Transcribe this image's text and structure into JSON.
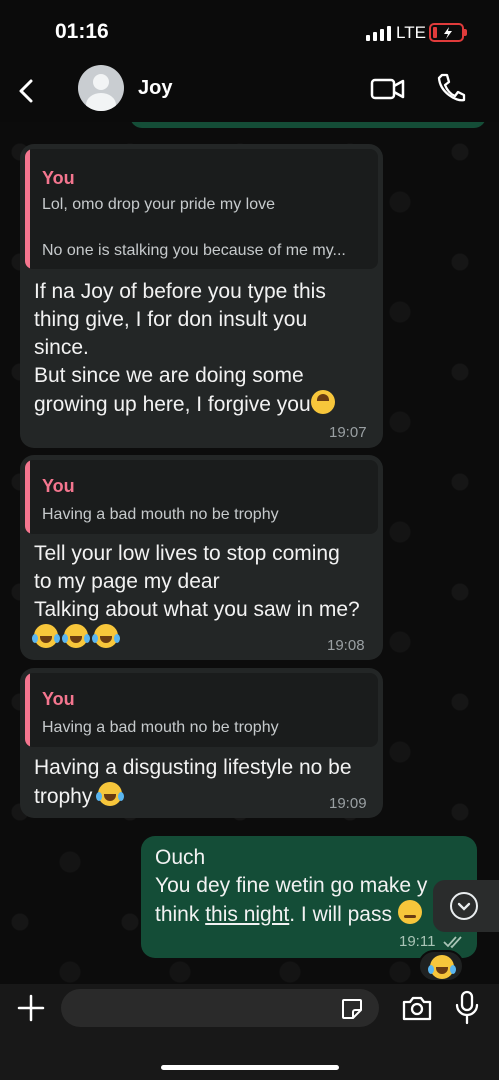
{
  "status_bar": {
    "time": "01:16",
    "network": "LTE"
  },
  "header": {
    "contact_name": "Joy"
  },
  "messages": [
    {
      "quote_author": "You",
      "quote_line1": "Lol, omo drop your pride my love",
      "quote_line2": "No one is stalking you because of me my...",
      "lines": [
        "If na Joy of before you type this",
        "thing give, I for don insult you",
        "since.",
        "But since we are doing some",
        "growing up here, I forgive you"
      ],
      "time": "19:07"
    },
    {
      "quote_author": "You",
      "quote_line1": "Having a bad mouth no be trophy",
      "lines": [
        "Tell your low lives to stop coming",
        "to my page my dear",
        "Talking about what you saw in me?"
      ],
      "time": "19:08"
    },
    {
      "quote_author": "You",
      "quote_line1": "Having a bad mouth no be trophy",
      "lines": [
        "Having a disgusting lifestyle no be",
        "trophy"
      ],
      "time": "19:09"
    },
    {
      "lines": [
        "Ouch",
        "You dey fine wetin go make y",
        "think",
        "this night",
        ". I will pass"
      ],
      "time": "19:11"
    }
  ],
  "icons": {
    "back": "chevron-left-icon",
    "video": "video-camera-icon",
    "phone": "phone-icon",
    "plus": "plus-icon",
    "sticker": "sticker-icon",
    "camera": "camera-icon",
    "mic": "microphone-icon",
    "scroll": "chevron-down-icon"
  },
  "colors": {
    "incoming": "#232626",
    "outgoing": "#144d37",
    "quote_accent": "#f4768f"
  }
}
